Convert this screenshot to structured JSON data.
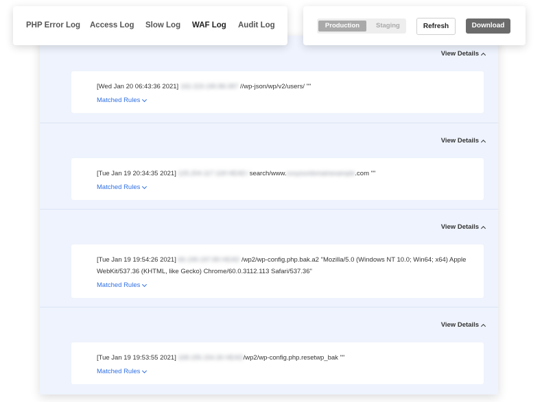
{
  "tabs": [
    {
      "label": "PHP Error Log",
      "active": false
    },
    {
      "label": "Access Log",
      "active": false
    },
    {
      "label": "Slow Log",
      "active": false
    },
    {
      "label": "WAF Log",
      "active": true
    },
    {
      "label": "Audit Log",
      "active": false
    }
  ],
  "environment": {
    "production_label": "Production",
    "staging_label": "Staging",
    "selected": "Production"
  },
  "actions": {
    "refresh_label": "Refresh",
    "download_label": "Download"
  },
  "colors": {
    "panel_bg": "#eef3fd",
    "link": "#2f6fe4",
    "download_bg": "#6b6b6b",
    "toggle_active": "#a9a9a9"
  },
  "entries": [
    {
      "view_details": "View Details",
      "timestamp": "[Wed Jan 20 06:43:36 2021]",
      "redacted_ip": "162.223.190.86.087",
      "request": " //wp-json/wp/v2/users/ \"\"",
      "matched_rules": "Matched Rules"
    },
    {
      "view_details": "View Details",
      "timestamp": "[Tue Jan 19 20:34:35 2021]",
      "redacted_ip": "125.204.117.118 HEAD /",
      "request_pre": "search/www.",
      "redacted_domain": "xxxyourdomainexample",
      "request": ".com \"\"",
      "matched_rules": "Matched Rules"
    },
    {
      "view_details": "View Details",
      "timestamp": "[Tue Jan 19 19:54:26 2021]",
      "redacted_ip": "66.199.197.89 HEAD",
      "request": "/wp2/wp-config.php.bak.a2 \"Mozilla/5.0 (Windows NT 10.0; Win64; x64) AppleWebKit/537.36 (KHTML, like Gecko) Chrome/60.0.3112.113 Safari/537.36\"",
      "matched_rules": "Matched Rules"
    },
    {
      "view_details": "View Details",
      "timestamp": "[Tue Jan 19 19:53:55 2021]",
      "redacted_ip": "168.155.154.26 HEAD",
      "request": "/wp2/wp-config.php.resetwp_bak \"\"",
      "matched_rules": "Matched Rules"
    }
  ]
}
